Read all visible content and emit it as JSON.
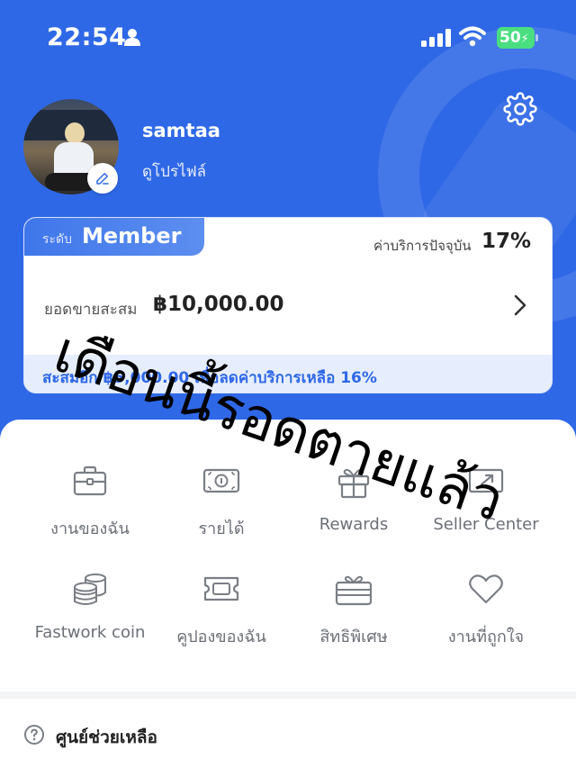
{
  "status_bar": {
    "time": "22:54",
    "battery": "50"
  },
  "profile": {
    "username": "samtaa",
    "view_profile": "ดูโปรไฟล์"
  },
  "member_card": {
    "tier_prefix": "ระดับ",
    "tier_name": "Member",
    "fee_label": "ค่าบริการปัจจุบัน",
    "fee_value": "17%",
    "sales_label": "ยอดขายสะสม",
    "sales_value": "฿10,000.00",
    "footer": "สะสมอีก ฿5,000.00 เพื่อลดค่าบริการเหลือ 16%"
  },
  "menu": {
    "items": [
      {
        "label": "งานของฉัน",
        "icon": "briefcase-icon"
      },
      {
        "label": "รายได้",
        "icon": "money-icon"
      },
      {
        "label": "Rewards",
        "icon": "gift-icon"
      },
      {
        "label": "Seller Center",
        "icon": "seller-center-icon"
      },
      {
        "label": "Fastwork coin",
        "icon": "coins-icon"
      },
      {
        "label": "คูปองของฉัน",
        "icon": "coupon-icon"
      },
      {
        "label": "สิทธิพิเศษ",
        "icon": "privilege-gift-card-icon"
      },
      {
        "label": "งานที่ถูกใจ",
        "icon": "heart-icon"
      }
    ]
  },
  "help": {
    "label": "ศูนย์ช่วยเหลือ"
  },
  "overlay": {
    "text": "เดือนนี้รอดตายแล้ว"
  },
  "colors": {
    "brand_blue": "#2f68e6",
    "battery_green": "#4ade80"
  }
}
